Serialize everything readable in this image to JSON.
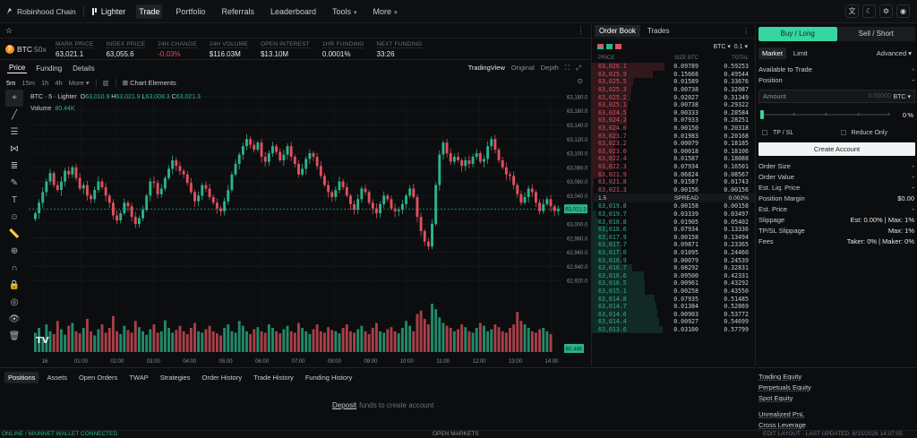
{
  "nav": {
    "brand": "Robinhood Chain",
    "brand2": "Lighter",
    "items": [
      "Trade",
      "Portfolio",
      "Referrals",
      "Leaderboard",
      "Tools",
      "More"
    ],
    "active": "Trade"
  },
  "market": {
    "pair": "BTC",
    "leverage": "50x",
    "stats": [
      {
        "label": "MARK PRICE",
        "value": "63,021.1",
        "neg": false
      },
      {
        "label": "INDEX PRICE",
        "value": "63,055.6",
        "neg": false
      },
      {
        "label": "24H CHANGE",
        "value": "-0.03%",
        "neg": true
      },
      {
        "label": "24H VOLUME",
        "value": "$116.03M",
        "neg": false
      },
      {
        "label": "OPEN INTEREST",
        "value": "$13.10M",
        "neg": false
      },
      {
        "label": "1HR FUNDING",
        "value": "0.0001%",
        "neg": false
      },
      {
        "label": "NEXT FUNDING",
        "value": "33:26",
        "neg": false
      }
    ]
  },
  "chart_tabs": {
    "left": [
      "Price",
      "Funding",
      "Details"
    ],
    "right": [
      "TradingView",
      "Original",
      "Depth"
    ]
  },
  "timeframes": [
    "5m",
    "15m",
    "1h",
    "4h",
    "More"
  ],
  "chart_elements": "Chart Elements",
  "legend": {
    "title": "BTC · 5 · Lighter",
    "o": "63,010.9",
    "h": "63,021.9",
    "l": "63,008.3",
    "c": "63,021.3"
  },
  "volume_label": "Volume",
  "volume_value": "80.44K",
  "price_tag": "63,021.3",
  "volume_tag": "80.44K",
  "chart_data": {
    "type": "candlestick",
    "y_ticks": [
      "63,180.0",
      "63,160.0",
      "63,140.0",
      "63,120.0",
      "63,100.0",
      "63,080.0",
      "63,060.0",
      "63,040.0",
      "63,020.0",
      "63,000.0",
      "62,980.0",
      "62,960.0",
      "62,940.0",
      "62,920.0"
    ],
    "x_ticks": [
      "16",
      "01:00",
      "02:00",
      "03:00",
      "04:00",
      "05:00",
      "06:00",
      "07:00",
      "08:00",
      "09:00",
      "10:00",
      "11:00",
      "12:00",
      "13:00",
      "14:00"
    ],
    "ylim": [
      62910,
      63185
    ],
    "close": [
      63015,
      63030,
      63045,
      63060,
      63072,
      63055,
      63048,
      63060,
      63075,
      63070,
      63080,
      63065,
      63050,
      63055,
      63040,
      63035,
      63048,
      63060,
      63052,
      63040,
      63030,
      63012,
      63005,
      63015,
      63030,
      63025,
      63010,
      63000,
      63008,
      63020,
      63040,
      63060,
      63058,
      63042,
      63050,
      63065,
      63078,
      63090,
      63082,
      63075,
      63070,
      63058,
      63045,
      63032,
      63040,
      63055,
      63050,
      63038,
      63030,
      63022,
      63018,
      63032,
      63048,
      63070,
      63085,
      63098,
      63110,
      63120,
      63112,
      63105,
      63115,
      63095,
      63088,
      63100,
      63110,
      63102,
      63090,
      63098,
      63110,
      63095,
      63085,
      63070,
      63078,
      63092,
      63100,
      63095,
      63082,
      63068,
      63055,
      63045,
      63038,
      63048,
      63060,
      63052,
      63040,
      63028,
      63020,
      63035,
      63050,
      63045,
      63030,
      63022,
      63015,
      63028,
      63040,
      63035,
      63022,
      63018,
      63020,
      63028,
      63040,
      63050,
      63038,
      63010,
      62990,
      62975,
      62968,
      63000,
      63055,
      63098,
      63115,
      63100,
      63088,
      63095,
      63090,
      63082,
      63090,
      63085,
      63095,
      63100,
      63088,
      63092,
      63110,
      63120,
      63105,
      63090,
      63080,
      63070,
      63068,
      63055,
      63042,
      63030,
      63038,
      63050,
      63045,
      63030,
      63018,
      63028,
      63035,
      63025,
      63018,
      63021.3
    ],
    "volume": [
      28,
      35,
      22,
      40,
      30,
      26,
      45,
      33,
      25,
      38,
      42,
      30,
      27,
      35,
      48,
      30,
      24,
      33,
      40,
      28,
      35,
      52,
      30,
      26,
      38,
      32,
      28,
      45,
      36,
      30,
      25,
      33,
      40,
      28,
      30,
      46,
      35,
      28,
      32,
      38,
      30,
      26,
      35,
      42,
      30,
      28,
      33,
      38,
      30,
      27,
      24,
      35,
      40,
      30,
      28,
      45,
      38,
      30,
      26,
      33,
      36,
      30,
      28,
      40,
      35,
      30,
      27,
      33,
      38,
      30,
      28,
      42,
      35,
      30,
      26,
      33,
      40,
      30,
      28,
      36,
      32,
      30,
      27,
      35,
      40,
      30,
      28,
      33,
      38,
      30,
      26,
      35,
      42,
      30,
      28,
      33,
      36,
      30,
      27,
      35,
      45,
      38,
      30,
      55,
      60,
      48,
      40,
      70,
      62,
      50,
      42,
      38,
      35,
      30,
      33,
      40,
      36,
      30,
      28,
      35,
      42,
      38,
      30,
      33,
      40,
      36,
      30,
      28,
      35,
      40,
      58,
      45,
      40,
      35,
      30,
      28,
      33,
      35,
      30,
      26
    ]
  },
  "orderbook": {
    "tabs": [
      "Order Book",
      "Trades"
    ],
    "unit": "BTC",
    "grouping": "0.1",
    "headers": [
      "PRICE",
      "SIZE BTC",
      "TOTAL"
    ],
    "asks": [
      [
        "63,026.1",
        "0.09789",
        "0.59253"
      ],
      [
        "63,025.9",
        "0.15668",
        "0.49544"
      ],
      [
        "63,025.5",
        "0.01589",
        "0.33676"
      ],
      [
        "63,025.3",
        "0.00738",
        "0.32087"
      ],
      [
        "63,025.2",
        "0.02027",
        "0.31349"
      ],
      [
        "63,025.1",
        "0.00738",
        "0.29322"
      ],
      [
        "63,024.5",
        "0.00333",
        "0.28584"
      ],
      [
        "63,024.2",
        "0.07933",
        "0.28251"
      ],
      [
        "63,024.0",
        "0.00150",
        "0.20318"
      ],
      [
        "63,023.7",
        "0.01983",
        "0.20168"
      ],
      [
        "63,023.2",
        "0.00079",
        "0.18185"
      ],
      [
        "63,023.0",
        "0.00018",
        "0.18106"
      ],
      [
        "63,022.4",
        "0.01587",
        "0.18088"
      ],
      [
        "63,022.3",
        "0.07934",
        "0.16501"
      ],
      [
        "63,021.9",
        "0.06824",
        "0.08567"
      ],
      [
        "63,021.8",
        "0.01587",
        "0.01743"
      ],
      [
        "63,021.3",
        "0.00156",
        "0.00156"
      ]
    ],
    "spread": {
      "value": "1.5",
      "label": "SPREAD",
      "pct": "0.002%"
    },
    "bids": [
      [
        "63,019.8",
        "0.00158",
        "0.00158"
      ],
      [
        "63,019.7",
        "0.03339",
        "0.03497"
      ],
      [
        "63,018.8",
        "0.01905",
        "0.05402"
      ],
      [
        "63,018.6",
        "0.07934",
        "0.13336"
      ],
      [
        "63,017.9",
        "0.00158",
        "0.13494"
      ],
      [
        "63,017.7",
        "0.09871",
        "0.23365"
      ],
      [
        "63,017.0",
        "0.01095",
        "0.24460"
      ],
      [
        "63,016.9",
        "0.00079",
        "0.24539"
      ],
      [
        "63,016.7",
        "0.08292",
        "0.32831"
      ],
      [
        "63,016.6",
        "0.09500",
        "0.42331"
      ],
      [
        "63,016.5",
        "0.00961",
        "0.43292"
      ],
      [
        "63,015.1",
        "0.00258",
        "0.43550"
      ],
      [
        "63,014.8",
        "0.07935",
        "0.51485"
      ],
      [
        "63,014.7",
        "0.01384",
        "0.52869"
      ],
      [
        "63,014.6",
        "0.00903",
        "0.53772"
      ],
      [
        "63,014.4",
        "0.00927",
        "0.54699"
      ],
      [
        "63,013.6",
        "0.03100",
        "0.57799"
      ]
    ]
  },
  "trade": {
    "buy": "Buy / Long",
    "sell": "Sell / Short",
    "order_types": [
      "Market",
      "Limit"
    ],
    "advanced": "Advanced",
    "available_label": "Available to Trade",
    "available_value": "-",
    "position_label": "Position",
    "position_value": "-",
    "amount_label": "Amount",
    "amount_placeholder": "0.00000",
    "amount_unit": "BTC",
    "slider_value": "0",
    "slider_unit": "%",
    "tpsl": "TP / SL",
    "reduce_only": "Reduce Only",
    "create_account": "Create Account",
    "details": [
      {
        "label": "Order Size",
        "value": "-"
      },
      {
        "label": "Order Value",
        "value": "-"
      },
      {
        "label": "Est. Liq. Price",
        "value": "-"
      },
      {
        "label": "Position Margin",
        "value": "$0.00"
      },
      {
        "label": "Est. Price",
        "value": "-"
      },
      {
        "label": "Slippage",
        "value": "Est: 0.00% | Max: 1%"
      },
      {
        "label": "TP/SL Slippage",
        "value": "Max: 1%"
      },
      {
        "label": "Fees",
        "value": "Taker: 0% | Maker: 0%"
      }
    ]
  },
  "bottom": {
    "tabs": [
      "Positions",
      "Assets",
      "Open Orders",
      "TWAP",
      "Strategies",
      "Order History",
      "Trade History",
      "Funding History"
    ],
    "deposit_link": "Deposit",
    "deposit_text": "funds to create account"
  },
  "account": [
    "Trading Equity",
    "Perpetuals Equity",
    "Spot Equity",
    "Unrealized PnL",
    "Cross Leverage"
  ],
  "status": {
    "left": "ONLINE / MAINNET WALLET CONNECTED",
    "center": "OPEN MARKETS",
    "right": "EDIT LAYOUT · LAST UPDATED: 8/15/2026 14:07:05"
  },
  "colors": {
    "up": "#2bb488",
    "down": "#e0505e",
    "accent": "#36d6a0"
  }
}
